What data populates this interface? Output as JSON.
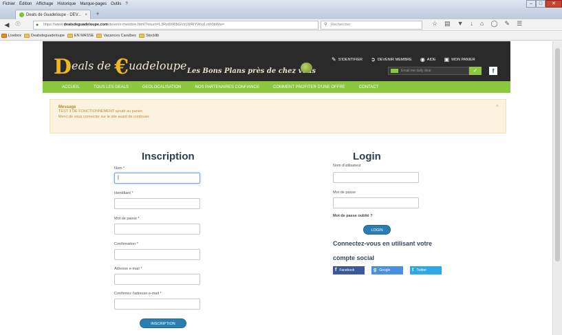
{
  "browser": {
    "menu": [
      "Fichier",
      "Édition",
      "Affichage",
      "Historique",
      "Marque-pages",
      "Outils",
      "?"
    ],
    "window_controls": [
      "–",
      "□",
      "✕"
    ],
    "tab_title": "Deals de Guadeloupe - DEV...",
    "tab_close": "×",
    "new_tab": "+",
    "url_prefix": "https://www.",
    "url_domain": "dealsdeguadeloupe.com",
    "url_rest": "/devenir-membre.html?return=L3RvdXRlbGVzLWRlYWxzLmh0bWw=",
    "search_placeholder": "Rechercher",
    "bookmarks": [
      "Livebox",
      "Dealsdeguadeloupe",
      "EN MASSE",
      "Vacances Caraïbes",
      "Stocklib"
    ]
  },
  "site": {
    "logo_letter_d": "D",
    "logo_text_1": "eals",
    "logo_text_de": "de",
    "logo_letter_g": "€",
    "logo_text_2": "uadeloupe",
    "tagline": "Les Bons Plans près de chez vous",
    "top_links": {
      "identify": "S'IDENTIFIER",
      "become_member": "DEVENIR MEMBRE",
      "help": "AIDE",
      "cart": "MON PANIER"
    },
    "newsletter_placeholder": "Email me daily deal",
    "newsletter_button": "✓",
    "facebook": "f",
    "menu": [
      "ACCUEIL",
      "TOUS LES DEALS",
      "GEOLOCALISATION",
      "NOS PARTENAIRES CONFIANCE",
      "COMMENT PROFITER D'UNE OFFRE",
      "CONTACT"
    ]
  },
  "message": {
    "title": "Message",
    "line1": "TEST 3 DE FONCTIONNEMENT ajouté au panier.",
    "line2": "Merci de vous connecter sur le site avant de continuer.",
    "close": "×"
  },
  "inscription": {
    "title": "Inscription",
    "fields": [
      {
        "label": "Nom *",
        "value": "|"
      },
      {
        "label": "Identifiant *",
        "value": ""
      },
      {
        "label": "Mot de passe *",
        "value": ""
      },
      {
        "label": "Confirmation *",
        "value": ""
      },
      {
        "label": "Adresse e-mail *",
        "value": ""
      },
      {
        "label": "Confirmez l'adresse e-mail *",
        "value": ""
      }
    ],
    "submit": "INSCRIPTION"
  },
  "login": {
    "title": "Login",
    "username_label": "Nom d'utilisateur",
    "password_label": "Mot de passe",
    "forgot": "Mot de passe oublié ?",
    "submit": "LOGIN",
    "social_text_1": "Connectez-vous en utilisant votre",
    "social_text_2": "compte social",
    "social": [
      {
        "label": "Facebook",
        "icon": "f",
        "color": "#3b5998"
      },
      {
        "label": "Google",
        "icon": "g",
        "color": "#4a8fe0"
      },
      {
        "label": "Twitter",
        "icon": "t",
        "color": "#2fa8e6"
      }
    ]
  }
}
